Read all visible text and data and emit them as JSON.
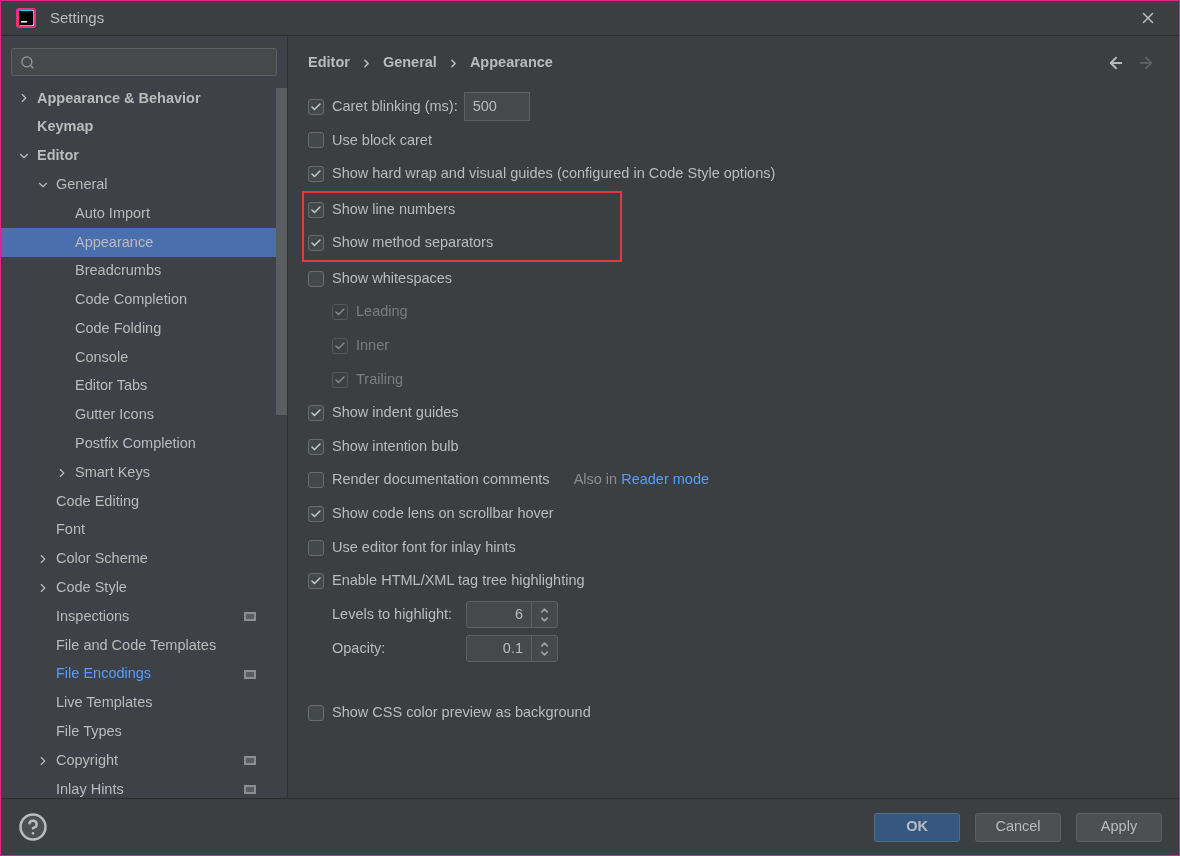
{
  "window": {
    "title": "Settings"
  },
  "sidebar": {
    "items": [
      {
        "label": "Appearance & Behavior",
        "selected": false,
        "expanded": false
      },
      {
        "label": "Keymap",
        "selected": false
      },
      {
        "label": "Editor",
        "selected": false,
        "expanded": true,
        "children": [
          {
            "label": "General",
            "selected": false,
            "expanded": true,
            "children": [
              {
                "label": "Auto Import",
                "selected": false
              },
              {
                "label": "Appearance",
                "selected": true
              },
              {
                "label": "Breadcrumbs",
                "selected": false
              },
              {
                "label": "Code Completion",
                "selected": false
              },
              {
                "label": "Code Folding",
                "selected": false
              },
              {
                "label": "Console",
                "selected": false
              },
              {
                "label": "Editor Tabs",
                "selected": false
              },
              {
                "label": "Gutter Icons",
                "selected": false
              },
              {
                "label": "Postfix Completion",
                "selected": false
              },
              {
                "label": "Smart Keys",
                "selected": false,
                "expanded": false
              }
            ]
          },
          {
            "label": "Code Editing",
            "selected": false
          },
          {
            "label": "Font",
            "selected": false
          },
          {
            "label": "Color Scheme",
            "selected": false,
            "expanded": false
          },
          {
            "label": "Code Style",
            "selected": false,
            "expanded": false
          },
          {
            "label": "Inspections",
            "selected": false,
            "project_scoped": true
          },
          {
            "label": "File and Code Templates",
            "selected": false
          },
          {
            "label": "File Encodings",
            "selected": false,
            "modified": true,
            "project_scoped": true
          },
          {
            "label": "Live Templates",
            "selected": false
          },
          {
            "label": "File Types",
            "selected": false
          },
          {
            "label": "Copyright",
            "selected": false,
            "expanded": false,
            "project_scoped": true
          },
          {
            "label": "Inlay Hints",
            "selected": false,
            "project_scoped": true
          }
        ]
      }
    ]
  },
  "breadcrumbs": [
    "Editor",
    "General",
    "Appearance"
  ],
  "nav": {
    "back_disabled": false,
    "forward_disabled": true
  },
  "options": [
    {
      "kind": "checkbox_field",
      "label": "Caret blinking (ms):",
      "checked": true,
      "value": "500"
    },
    {
      "kind": "checkbox",
      "label": "Use block caret",
      "checked": false
    },
    {
      "kind": "checkbox",
      "label": "Show hard wrap and visual guides (configured in Code Style options)",
      "checked": true
    },
    {
      "kind": "checkbox",
      "label": "Show line numbers",
      "checked": true,
      "highlighted": true
    },
    {
      "kind": "checkbox",
      "label": "Show method separators",
      "checked": true,
      "highlighted": true
    },
    {
      "kind": "checkbox",
      "label": "Show whitespaces",
      "checked": false,
      "children": [
        {
          "kind": "checkbox",
          "label": "Leading",
          "checked": true,
          "disabled": true
        },
        {
          "kind": "checkbox",
          "label": "Inner",
          "checked": true,
          "disabled": true
        },
        {
          "kind": "checkbox",
          "label": "Trailing",
          "checked": true,
          "disabled": true
        }
      ]
    },
    {
      "kind": "checkbox",
      "label": "Show indent guides",
      "checked": true
    },
    {
      "kind": "checkbox",
      "label": "Show intention bulb",
      "checked": true
    },
    {
      "kind": "checkbox",
      "label": "Render documentation comments",
      "checked": false,
      "note": "Also in",
      "link": "Reader mode"
    },
    {
      "kind": "checkbox",
      "label": "Show code lens on scrollbar hover",
      "checked": true
    },
    {
      "kind": "checkbox",
      "label": "Use editor font for inlay hints",
      "checked": false
    },
    {
      "kind": "checkbox",
      "label": "Enable HTML/XML tag tree highlighting",
      "checked": true,
      "children": [
        {
          "kind": "spinner",
          "label": "Levels to highlight:",
          "value": "6"
        },
        {
          "kind": "spinner",
          "label": "Opacity:",
          "value": "0.1"
        }
      ]
    },
    {
      "kind": "checkbox",
      "label": "Show CSS color preview as background",
      "checked": false,
      "spaced": true
    }
  ],
  "footer": {
    "buttons": [
      {
        "label": "OK",
        "primary": true
      },
      {
        "label": "Cancel",
        "primary": false
      },
      {
        "label": "Apply",
        "primary": false
      }
    ]
  }
}
